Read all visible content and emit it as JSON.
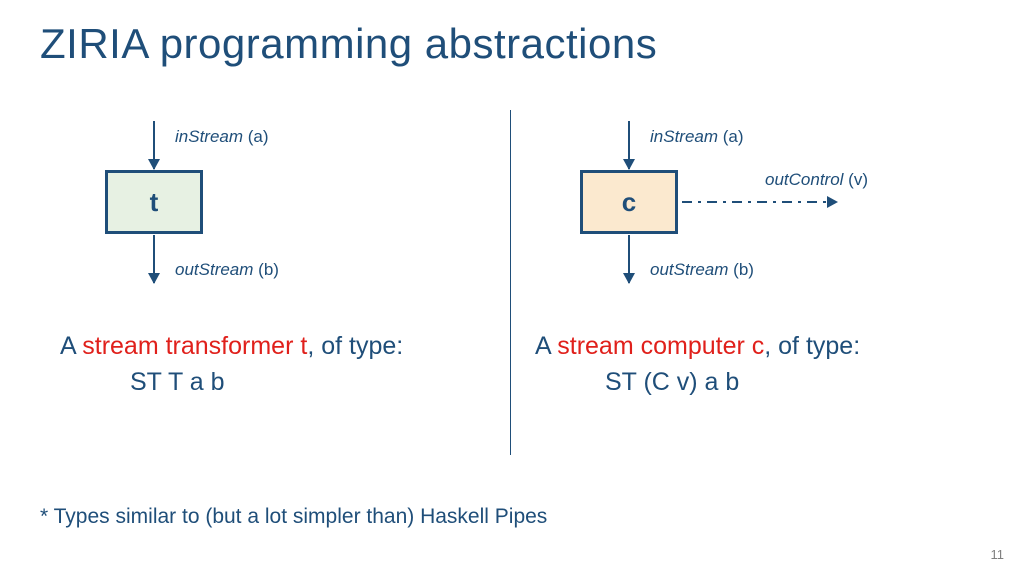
{
  "title": "ZIRIA programming abstractions",
  "left": {
    "inStream_i": "inStream",
    "inStream_p": " (a)",
    "boxLabel": "t",
    "outStream_i": "outStream",
    "outStream_p": " (b)",
    "desc_pre": "A ",
    "desc_red": "stream transformer t",
    "desc_post": ", of type:",
    "typeLine": "ST T a b"
  },
  "right": {
    "inStream_i": "inStream",
    "inStream_p": " (a)",
    "boxLabel": "c",
    "outStream_i": "outStream",
    "outStream_p": " (b)",
    "outControl_i": "outControl",
    "outControl_p": " (v)",
    "desc_pre": "A ",
    "desc_red": "stream computer c",
    "desc_post": ", of type:",
    "typeLine": "ST (C v) a b"
  },
  "footnote": "* Types similar to (but a lot simpler than) Haskell Pipes",
  "pageNumber": "11"
}
